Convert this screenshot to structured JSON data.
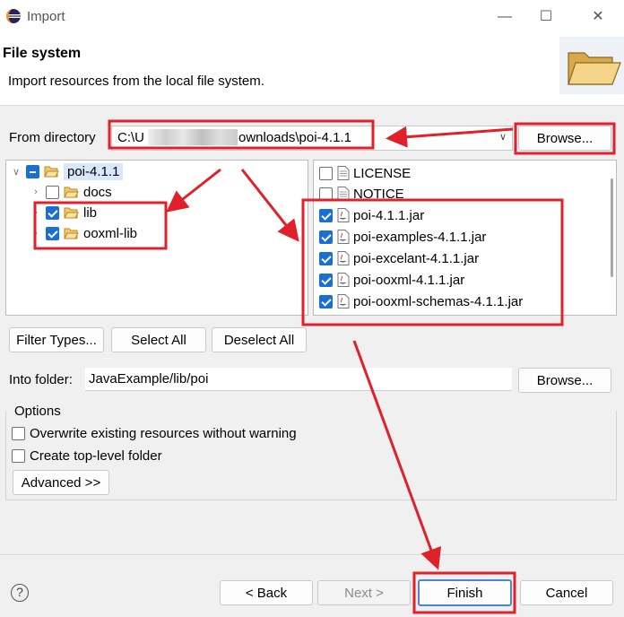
{
  "window": {
    "title": "Import",
    "minimize": "—",
    "maximize": "☐",
    "close": "✕"
  },
  "banner": {
    "title": "File system",
    "description": "Import resources from the local file system."
  },
  "from_directory": {
    "label": "From directory",
    "value_start": "C:\\U",
    "value_end": "ownloads\\poi-4.1.1",
    "browse_label": "Browse..."
  },
  "tree": {
    "root": "poi-4.1.1",
    "children": [
      {
        "label": "docs",
        "checked": false
      },
      {
        "label": "lib",
        "checked": true
      },
      {
        "label": "ooxml-lib",
        "checked": true
      }
    ]
  },
  "files": [
    {
      "label": "LICENSE",
      "checked": false,
      "type": "text"
    },
    {
      "label": "NOTICE",
      "checked": false,
      "type": "text"
    },
    {
      "label": "poi-4.1.1.jar",
      "checked": true,
      "type": "jar"
    },
    {
      "label": "poi-examples-4.1.1.jar",
      "checked": true,
      "type": "jar"
    },
    {
      "label": "poi-excelant-4.1.1.jar",
      "checked": true,
      "type": "jar"
    },
    {
      "label": "poi-ooxml-4.1.1.jar",
      "checked": true,
      "type": "jar"
    },
    {
      "label": "poi-ooxml-schemas-4.1.1.jar",
      "checked": true,
      "type": "jar"
    }
  ],
  "selection_buttons": {
    "filter_types": "Filter Types...",
    "select_all": "Select All",
    "deselect_all": "Deselect All"
  },
  "into_folder": {
    "label": "Into folder:",
    "value": "JavaExample/lib/poi",
    "browse_label": "Browse..."
  },
  "options": {
    "title": "Options",
    "overwrite": "Overwrite existing resources without warning",
    "create_top_level": "Create top-level folder",
    "advanced": "Advanced >>"
  },
  "footer": {
    "help": "?",
    "back": "< Back",
    "next": "Next >",
    "finish": "Finish",
    "cancel": "Cancel"
  },
  "colors": {
    "annotation": "#e0202a",
    "checkbox": "#1a6fd4"
  }
}
